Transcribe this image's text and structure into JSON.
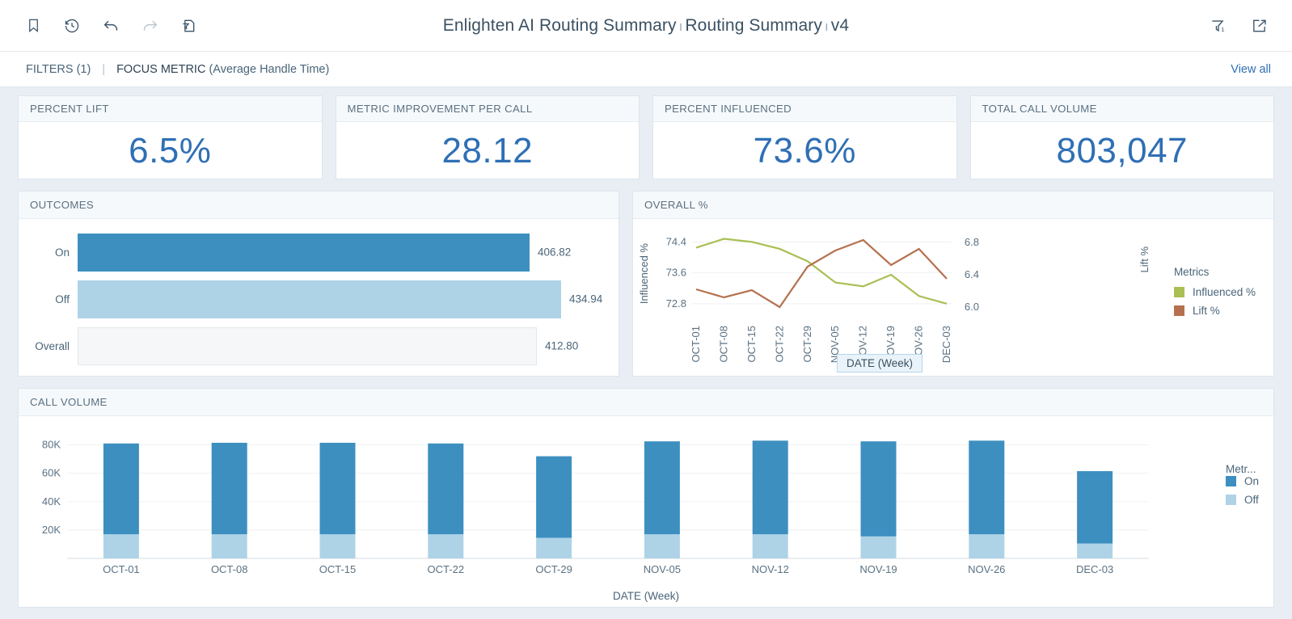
{
  "topbar": {
    "title_main": "Enlighten AI Routing Summary",
    "title_mid": "Routing Summary",
    "title_ver": "v4",
    "sep": "ı",
    "icons": {
      "bookmark": "bookmark-icon",
      "history": "history-icon",
      "undo": "undo-icon",
      "redo": "redo-icon",
      "filter_doc": "filter-document-icon",
      "filter": "filter-icon",
      "filter_count": "1",
      "share": "share-icon"
    }
  },
  "filterbar": {
    "filters_label": "FILTERS (1)",
    "divider": "|",
    "focus_label": "FOCUS METRIC",
    "focus_value": "(Average Handle Time)",
    "view_all": "View all"
  },
  "kpis": [
    {
      "label": "PERCENT LIFT",
      "value": "6.5%"
    },
    {
      "label": "METRIC IMPROVEMENT PER CALL",
      "value": "28.12"
    },
    {
      "label": "PERCENT INFLUENCED",
      "value": "73.6%"
    },
    {
      "label": "TOTAL CALL VOLUME",
      "value": "803,047"
    }
  ],
  "outcomes": {
    "title": "OUTCOMES",
    "rows": [
      {
        "label": "On",
        "value": "406.82",
        "num": 406.82,
        "style": "on"
      },
      {
        "label": "Off",
        "value": "434.94",
        "num": 434.94,
        "style": "off"
      },
      {
        "label": "Overall",
        "value": "412.80",
        "num": 412.8,
        "style": "overall"
      }
    ]
  },
  "overall_panel": {
    "title": "OVERALL %",
    "legend_title": "Metrics",
    "x_pill": "DATE (Week)"
  },
  "call_volume": {
    "title": "CALL VOLUME",
    "xlabel": "DATE (Week)",
    "legend_title": "Metr..."
  },
  "chart_data": [
    {
      "type": "line",
      "title": "OVERALL %",
      "xlabel": "DATE (Week)",
      "ylabel": "Influenced %",
      "y2label": "Lift %",
      "categories": [
        "OCT-01",
        "OCT-08",
        "OCT-15",
        "OCT-22",
        "OCT-29",
        "NOV-05",
        "NOV-12",
        "NOV-19",
        "NOV-26",
        "DEC-03"
      ],
      "yticks": [
        72.8,
        73.6,
        74.4
      ],
      "ylim": [
        72.4,
        74.7
      ],
      "y2ticks": [
        6.0,
        6.4,
        6.8
      ],
      "y2lim": [
        5.85,
        6.95
      ],
      "grid": true,
      "legend_position": "right",
      "series": [
        {
          "name": "Influenced %",
          "color": "#a9bf54",
          "axis": "left",
          "values": [
            74.25,
            74.48,
            74.4,
            74.22,
            73.9,
            73.35,
            73.25,
            73.55,
            73.0,
            72.8
          ]
        },
        {
          "name": "Lift %",
          "color": "#b5714f",
          "axis": "right",
          "values": [
            6.22,
            6.12,
            6.21,
            6.0,
            6.5,
            6.7,
            6.83,
            6.52,
            6.72,
            6.35
          ]
        }
      ]
    },
    {
      "type": "bar",
      "stacked": true,
      "title": "CALL VOLUME",
      "xlabel": "DATE (Week)",
      "ylabel": "",
      "categories": [
        "OCT-01",
        "OCT-08",
        "OCT-15",
        "OCT-22",
        "OCT-29",
        "NOV-05",
        "NOV-12",
        "NOV-19",
        "NOV-26",
        "DEC-03"
      ],
      "yticks": [
        "20K",
        "40K",
        "60K",
        "80K"
      ],
      "ytickvals": [
        20000,
        40000,
        60000,
        80000
      ],
      "ylim": [
        0,
        90000
      ],
      "grid": true,
      "legend_position": "right",
      "series": [
        {
          "name": "Off",
          "color": "#aed3e7",
          "values": [
            17000,
            17000,
            17000,
            17000,
            14500,
            17000,
            17000,
            15500,
            17000,
            10500
          ]
        },
        {
          "name": "On",
          "color": "#3d8fc0",
          "values": [
            64000,
            64500,
            64500,
            64000,
            57500,
            65500,
            66000,
            67000,
            66000,
            51000
          ]
        }
      ]
    }
  ]
}
